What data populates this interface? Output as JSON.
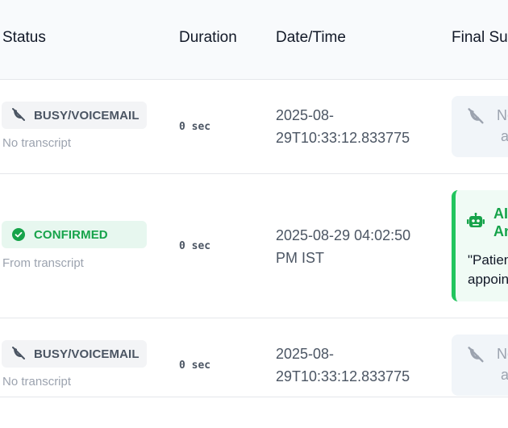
{
  "columns": {
    "status": "Status",
    "duration": "Duration",
    "datetime": "Date/Time",
    "final_summary": "Final Su"
  },
  "rows": [
    {
      "status_label": "BUSY/VOICEMAIL",
      "status_icon": "phone-slash-icon",
      "sub": "No transcript",
      "duration": "0 sec",
      "datetime_l1": "2025-08-",
      "datetime_l2": "29T10:33:12.833775",
      "summary_t1": "No",
      "summary_t2": "a"
    },
    {
      "status_label": "CONFIRMED",
      "status_icon": "check-circle-icon",
      "sub": "From transcript",
      "duration": "0 sec",
      "datetime_l1": "2025-08-29 04:02:50",
      "datetime_l2": "PM IST",
      "summary_h1": "AI",
      "summary_h2": "An",
      "summary_q1": "\"Patien",
      "summary_q2": "appoin"
    },
    {
      "status_label": "BUSY/VOICEMAIL",
      "status_icon": "phone-slash-icon",
      "sub": "No transcript",
      "duration": "0 sec",
      "datetime_l1": "2025-08-",
      "datetime_l2": "29T10:33:12.833775",
      "summary_t1": "No",
      "summary_t2": "a"
    }
  ],
  "colors": {
    "busy": "#4b5563",
    "confirmed": "#16a34a",
    "header_bg": "#f8fafc"
  }
}
